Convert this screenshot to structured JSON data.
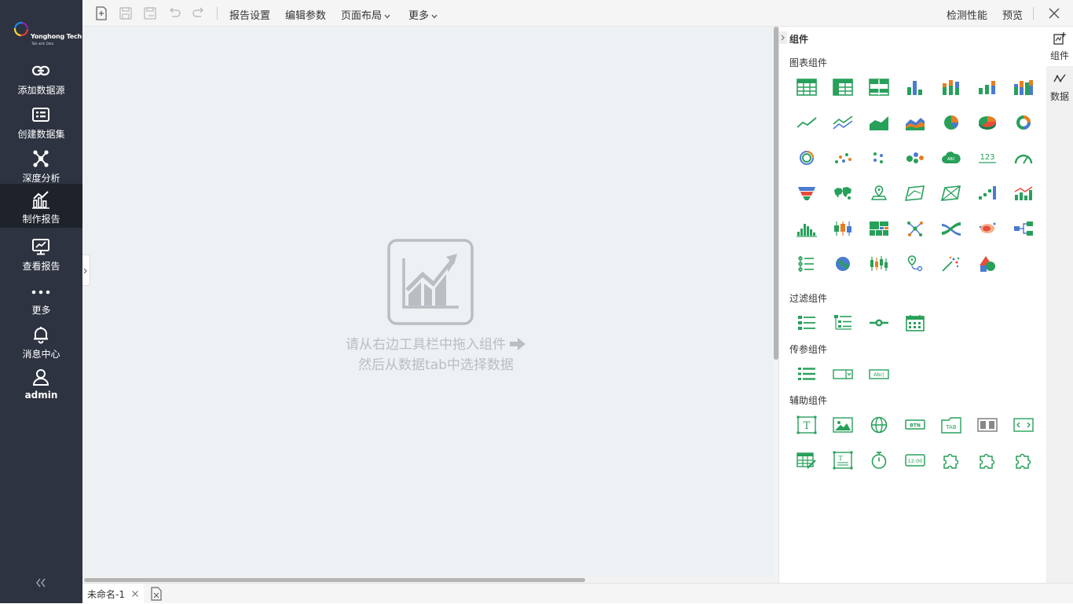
{
  "brand": {
    "name": "Yonghong Tech",
    "slogan": "Talk with Data"
  },
  "nav": [
    {
      "label": "添加数据源",
      "icon": "link-icon"
    },
    {
      "label": "创建数据集",
      "icon": "dataset-icon"
    },
    {
      "label": "深度分析",
      "icon": "network-icon"
    },
    {
      "label": "制作报告",
      "icon": "chart-bar-icon",
      "active": true
    },
    {
      "label": "查看报告",
      "icon": "monitor-chart-icon"
    },
    {
      "label": "更多",
      "icon": "more-dots-icon"
    },
    {
      "label": "消息中心",
      "icon": "bell-icon"
    },
    {
      "label": "admin",
      "icon": "user-icon"
    }
  ],
  "toolbar": {
    "menus": [
      "报告设置",
      "编辑参数",
      "页面布局",
      "更多"
    ],
    "right": [
      "检测性能",
      "预览"
    ]
  },
  "canvas": {
    "hint_line1": "请从右边工具栏中拖入组件",
    "hint_line2": "然后从数据tab中选择数据"
  },
  "bottom": {
    "doc_tab": "未命名-1"
  },
  "panel": {
    "title": "组件",
    "sections": [
      "图表组件",
      "过滤组件",
      "传参组件",
      "辅助组件"
    ]
  },
  "righttabs": [
    "组件",
    "数据"
  ],
  "colors": {
    "accent": "#27a05a",
    "nav_bg": "#2d3340",
    "canvas_bg": "#edf1f4"
  }
}
